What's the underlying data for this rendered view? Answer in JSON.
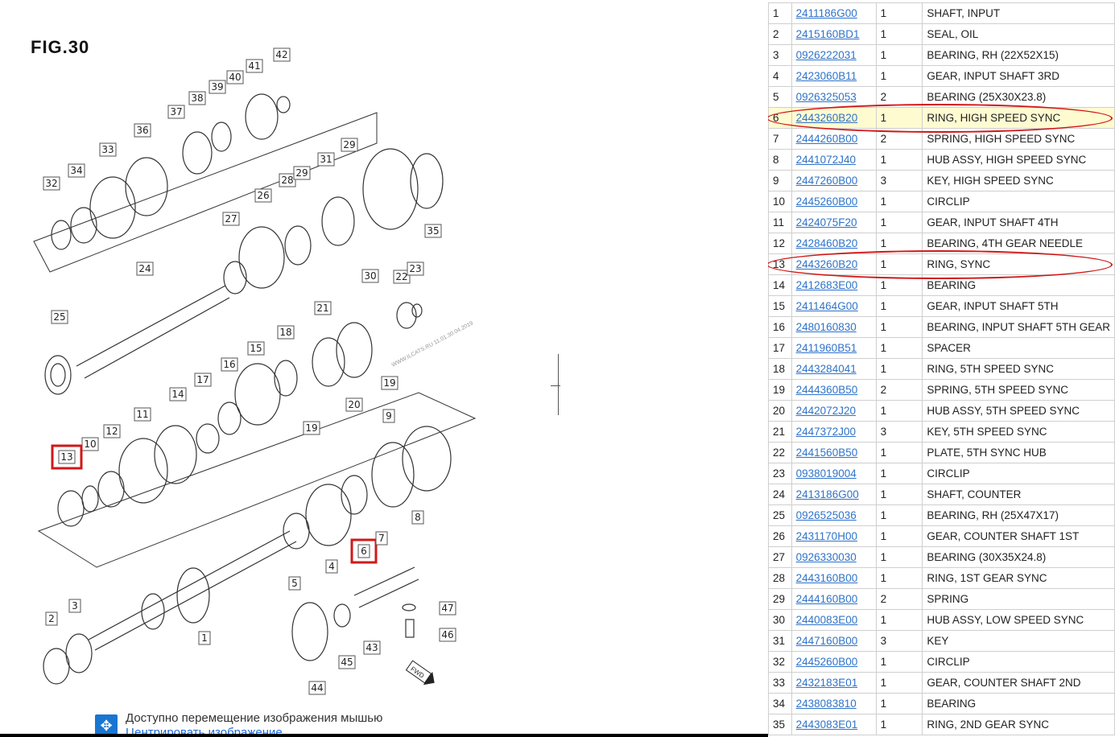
{
  "diagram": {
    "figure_title": "FIG.30",
    "callouts": [
      "1",
      "2",
      "3",
      "4",
      "5",
      "6",
      "7",
      "8",
      "9",
      "10",
      "11",
      "12",
      "13",
      "14",
      "15",
      "16",
      "17",
      "18",
      "19",
      "19",
      "20",
      "21",
      "22",
      "23",
      "24",
      "25",
      "26",
      "27",
      "28",
      "29",
      "29",
      "30",
      "31",
      "32",
      "33",
      "34",
      "35",
      "36",
      "37",
      "38",
      "39",
      "40",
      "41",
      "42",
      "43",
      "44",
      "45",
      "46",
      "47"
    ],
    "highlighted_callouts": [
      "13",
      "6"
    ],
    "watermark": "WWW.ILCATS.RU 11.01.30.04.2019"
  },
  "nav_hint": {
    "text": "Доступно перемещение изображения мышью",
    "center_link": "Центрировать изображение",
    "icon": "move-arrows-icon"
  },
  "parts_table": {
    "rows": [
      {
        "no": "1",
        "code": "2411186G00",
        "qty": "1",
        "name": "SHAFT, INPUT"
      },
      {
        "no": "2",
        "code": "2415160BD1",
        "qty": "1",
        "name": "SEAL, OIL"
      },
      {
        "no": "3",
        "code": "0926222031",
        "qty": "1",
        "name": "BEARING, RH (22X52X15)"
      },
      {
        "no": "4",
        "code": "2423060B11",
        "qty": "1",
        "name": "GEAR, INPUT SHAFT 3RD"
      },
      {
        "no": "5",
        "code": "0926325053",
        "qty": "2",
        "name": "BEARING (25X30X23.8)"
      },
      {
        "no": "6",
        "code": "2443260B20",
        "qty": "1",
        "name": "RING, HIGH SPEED SYNC"
      },
      {
        "no": "7",
        "code": "2444260B00",
        "qty": "2",
        "name": "SPRING, HIGH SPEED SYNC"
      },
      {
        "no": "8",
        "code": "2441072J40",
        "qty": "1",
        "name": "HUB ASSY, HIGH SPEED SYNC"
      },
      {
        "no": "9",
        "code": "2447260B00",
        "qty": "3",
        "name": "KEY, HIGH SPEED SYNC"
      },
      {
        "no": "10",
        "code": "2445260B00",
        "qty": "1",
        "name": "CIRCLIP"
      },
      {
        "no": "11",
        "code": "2424075F20",
        "qty": "1",
        "name": "GEAR, INPUT SHAFT 4TH"
      },
      {
        "no": "12",
        "code": "2428460B20",
        "qty": "1",
        "name": "BEARING, 4TH GEAR NEEDLE"
      },
      {
        "no": "13",
        "code": "2443260B20",
        "qty": "1",
        "name": "RING, SYNC"
      },
      {
        "no": "14",
        "code": "2412683E00",
        "qty": "1",
        "name": "BEARING"
      },
      {
        "no": "15",
        "code": "2411464G00",
        "qty": "1",
        "name": "GEAR, INPUT SHAFT 5TH"
      },
      {
        "no": "16",
        "code": "2480160830",
        "qty": "1",
        "name": "BEARING, INPUT SHAFT 5TH GEAR"
      },
      {
        "no": "17",
        "code": "2411960B51",
        "qty": "1",
        "name": "SPACER"
      },
      {
        "no": "18",
        "code": "2443284041",
        "qty": "1",
        "name": "RING, 5TH SPEED SYNC"
      },
      {
        "no": "19",
        "code": "2444360B50",
        "qty": "2",
        "name": "SPRING, 5TH SPEED SYNC"
      },
      {
        "no": "20",
        "code": "2442072J20",
        "qty": "1",
        "name": "HUB ASSY, 5TH SPEED SYNC"
      },
      {
        "no": "21",
        "code": "2447372J00",
        "qty": "3",
        "name": "KEY, 5TH SPEED SYNC"
      },
      {
        "no": "22",
        "code": "2441560B50",
        "qty": "1",
        "name": "PLATE, 5TH SYNC HUB"
      },
      {
        "no": "23",
        "code": "0938019004",
        "qty": "1",
        "name": "CIRCLIP"
      },
      {
        "no": "24",
        "code": "2413186G00",
        "qty": "1",
        "name": "SHAFT, COUNTER"
      },
      {
        "no": "25",
        "code": "0926525036",
        "qty": "1",
        "name": "BEARING, RH (25X47X17)"
      },
      {
        "no": "26",
        "code": "2431170H00",
        "qty": "1",
        "name": "GEAR, COUNTER SHAFT 1ST"
      },
      {
        "no": "27",
        "code": "0926330030",
        "qty": "1",
        "name": "BEARING (30X35X24.8)"
      },
      {
        "no": "28",
        "code": "2443160B00",
        "qty": "1",
        "name": "RING, 1ST GEAR SYNC"
      },
      {
        "no": "29",
        "code": "2444160B00",
        "qty": "2",
        "name": "SPRING"
      },
      {
        "no": "30",
        "code": "2440083E00",
        "qty": "1",
        "name": "HUB ASSY, LOW SPEED SYNC"
      },
      {
        "no": "31",
        "code": "2447160B00",
        "qty": "3",
        "name": "KEY"
      },
      {
        "no": "32",
        "code": "2445260B00",
        "qty": "1",
        "name": "CIRCLIP"
      },
      {
        "no": "33",
        "code": "2432183E01",
        "qty": "1",
        "name": "GEAR, COUNTER SHAFT 2ND"
      },
      {
        "no": "34",
        "code": "2438083810",
        "qty": "1",
        "name": "BEARING"
      },
      {
        "no": "35",
        "code": "2443083E01",
        "qty": "1",
        "name": "RING, 2ND GEAR SYNC"
      }
    ],
    "highlighted_row": "6",
    "outlined_rows": [
      "6",
      "13"
    ],
    "colors": {
      "highlight_bg": "#fffbd1",
      "outline": "#d01818",
      "link": "#2f73c9"
    }
  }
}
